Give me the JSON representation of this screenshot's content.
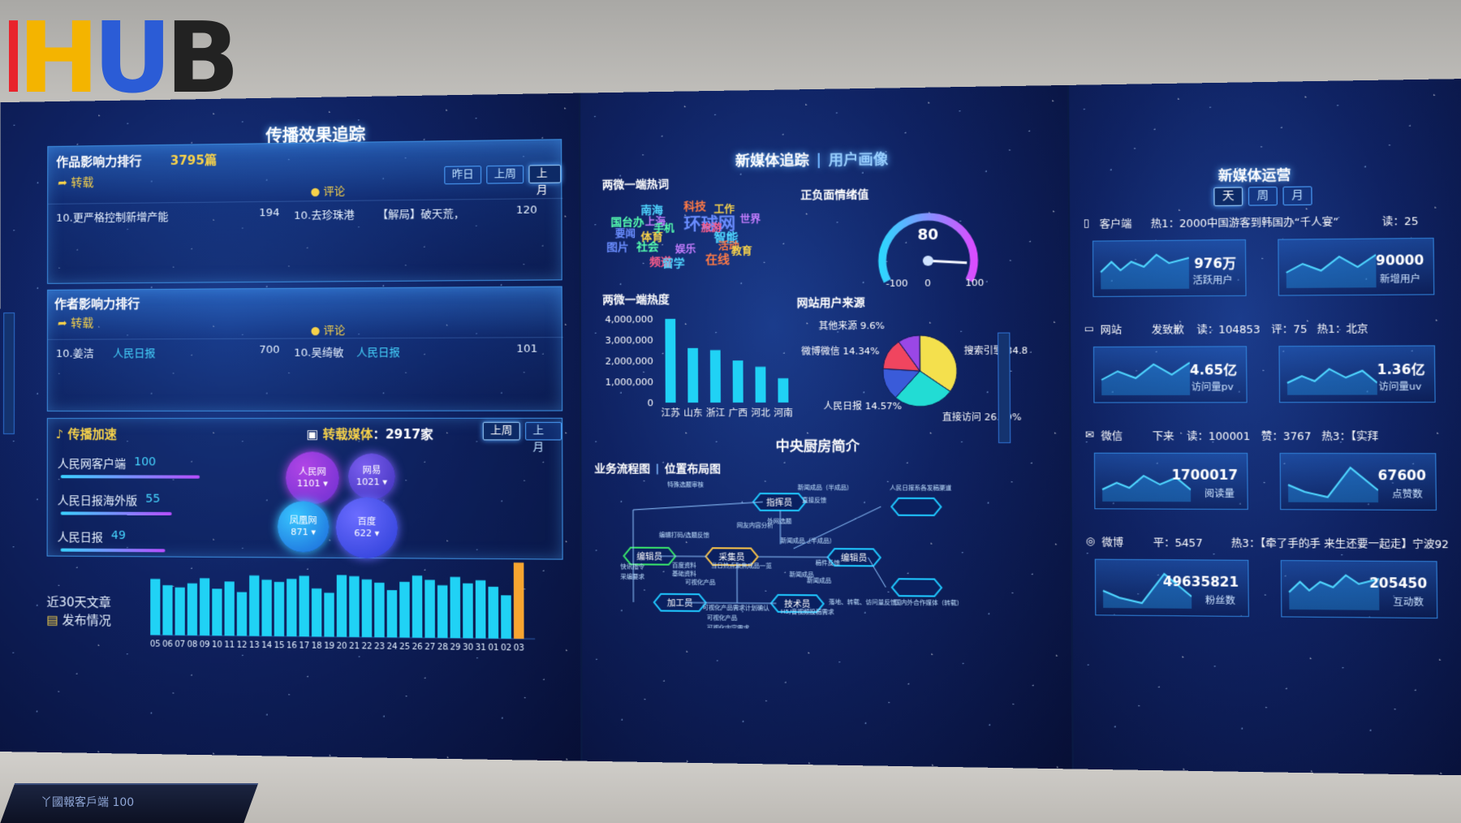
{
  "logo": {
    "text": "HUB"
  },
  "left_panel": {
    "title": "传播效果追踪",
    "work_rank": {
      "title": "作品影响力排行",
      "count": "3795篇",
      "tabs": [
        "昨日",
        "上周",
        "上月"
      ],
      "active_tab": "上月",
      "repost_label": "转载",
      "comment_label": "评论",
      "repost_item": {
        "rank_title": "10.更严格控制新增产能",
        "value": "194"
      },
      "comment_item": {
        "rank_title": "10.去珍珠港",
        "extra": "【解局】破天荒，",
        "value": "120"
      }
    },
    "author_rank": {
      "title": "作者影响力排行",
      "repost_label": "转载",
      "comment_label": "评论",
      "repost_item": {
        "name": "10.姜洁",
        "media": "人民日报",
        "value": "700"
      },
      "comment_item": {
        "name": "10.吴绮敏",
        "media": "人民日报",
        "value": "101"
      }
    },
    "accel": {
      "title": "传播加速",
      "items": [
        {
          "name": "人民网客户端",
          "value": "100",
          "ratio": 1.0
        },
        {
          "name": "人民日报海外版",
          "value": "55",
          "ratio": 0.8
        },
        {
          "name": "人民日报",
          "value": "49",
          "ratio": 0.75
        }
      ]
    },
    "repost_media": {
      "title": "转载媒体",
      "count": "：2917家",
      "tabs": [
        "上周",
        "上月"
      ],
      "active_tab": "上周",
      "bubbles": [
        {
          "name": "人民网",
          "value": "1101"
        },
        {
          "name": "网易",
          "value": "1021"
        },
        {
          "name": "凤凰网",
          "value": "871"
        },
        {
          "name": "百度",
          "value": "622"
        }
      ]
    },
    "monthly": {
      "title_line1": "近30天文章",
      "title_line2": "发布情况",
      "peak_label": "144",
      "categories": [
        "05",
        "06",
        "07",
        "08",
        "09",
        "10",
        "11",
        "12",
        "13",
        "14",
        "15",
        "16",
        "17",
        "18",
        "19",
        "20",
        "21",
        "22",
        "23",
        "24",
        "25",
        "26",
        "27",
        "28",
        "29",
        "30",
        "31",
        "01",
        "02",
        "03"
      ],
      "values": [
        108,
        96,
        92,
        100,
        110,
        90,
        104,
        84,
        116,
        108,
        104,
        110,
        116,
        92,
        84,
        118,
        116,
        110,
        104,
        90,
        106,
        118,
        110,
        100,
        116,
        104,
        110,
        98,
        82,
        144
      ]
    }
  },
  "middle_panel": {
    "title": "新媒体追踪",
    "title2": "用户画像",
    "wordcloud": {
      "title": "两微一端热词",
      "words": [
        "南海",
        "科技",
        "工作",
        "环球网",
        "国台办",
        "上海",
        "旅游",
        "智能",
        "活动",
        "体育",
        "图片",
        "社会",
        "娱乐",
        "频道",
        "留学",
        "在线",
        "教育",
        "要闻",
        "手机",
        "世界"
      ]
    },
    "gauge": {
      "title": "正负面情绪值",
      "value": "80",
      "min": "-100",
      "mid": "0",
      "max": "100",
      "fraction": 0.9
    },
    "heat_chart": {
      "title": "两微一端热度",
      "type": "bar",
      "categories": [
        "江苏",
        "山东",
        "浙江",
        "广西",
        "河北",
        "河南"
      ],
      "values": [
        4000000,
        2600000,
        2500000,
        2000000,
        1700000,
        1150000
      ],
      "ytick_labels": [
        "4,000,000",
        "3,000,000",
        "2,000,000",
        "1,000,000",
        "0"
      ]
    },
    "source_chart": {
      "title": "网站用户来源",
      "type": "pie",
      "slices": [
        {
          "name": "搜索引擎",
          "value": 34.8,
          "label": "搜索引擎 34.8",
          "color": "#f4e04d"
        },
        {
          "name": "直接访问",
          "value": 26.69,
          "label": "直接访问 26.69%",
          "color": "#22dcd4"
        },
        {
          "name": "人民日报",
          "value": 14.57,
          "label": "人民日报 14.57%",
          "color": "#3a5bd9"
        },
        {
          "name": "微博微信",
          "value": 14.34,
          "label": "微博微信 14.34%",
          "color": "#f0455f"
        },
        {
          "name": "其他来源",
          "value": 9.6,
          "label": "其他来源 9.6%",
          "color": "#9a47e6"
        }
      ]
    },
    "kitchen": {
      "title": "中央厨房简介",
      "tab1": "业务流程图",
      "tab2": "位置布局图",
      "nodes": [
        "指挥员",
        "采集员",
        "编辑员",
        "加工员",
        "技术员",
        "编辑员"
      ],
      "notes": [
        "特殊选题审核",
        "新闻成品（半成品）",
        "直接反馈",
        "人民日报系各发稿渠道",
        "当日热点聚焦成品一览",
        "编辑打码/选题反馈",
        "新闻成品（半成品）",
        "稿件反馈",
        "快讯指令",
        "百度资料",
        "基础资料",
        "采编要求",
        "新闻成品",
        "网友内容分析",
        "外网选题",
        "可视化产品需求计划确认",
        "可视化产品",
        "可视化内容需求",
        "新闻成品",
        "落地、转载、访问量反馈",
        "国内外合作媒体（转载）",
        "可视化产品",
        "H5/音视频投稿需求"
      ]
    }
  },
  "right_panel": {
    "title": "新媒体运营",
    "tabs": [
      "天",
      "周",
      "月"
    ],
    "active_tab": "天",
    "channels": [
      {
        "name": "客户端",
        "info": "热1：2000中国游客到韩国办“千人宴”",
        "read": "读：25",
        "cards": [
          {
            "value": "976万",
            "label": "活跃用户"
          },
          {
            "value": "90000",
            "label": "新增用户"
          }
        ]
      },
      {
        "name": "网站",
        "info": "发致歉",
        "read": "读：104853",
        "comment": "评：75",
        "hot": "热1：北京",
        "cards": [
          {
            "value": "4.65亿",
            "label": "访问量pv"
          },
          {
            "value": "1.36亿",
            "label": "访问量uv"
          }
        ]
      },
      {
        "name": "微信",
        "info": "下来",
        "read": "读：100001",
        "comment": "赞：3767",
        "hot": "热3：【实拜",
        "cards": [
          {
            "value": "1700017",
            "label": "阅读量"
          },
          {
            "value": "67600",
            "label": "点赞数"
          }
        ]
      },
      {
        "name": "微博",
        "info": "平：5457",
        "hot": "热3：【牵了手的手 来生还要一起走】宁波92",
        "cards": [
          {
            "value": "49635821",
            "label": "粉丝数"
          },
          {
            "value": "205450",
            "label": "互动数"
          }
        ]
      }
    ]
  },
  "desk_text": "丫國報客戶端  100"
}
